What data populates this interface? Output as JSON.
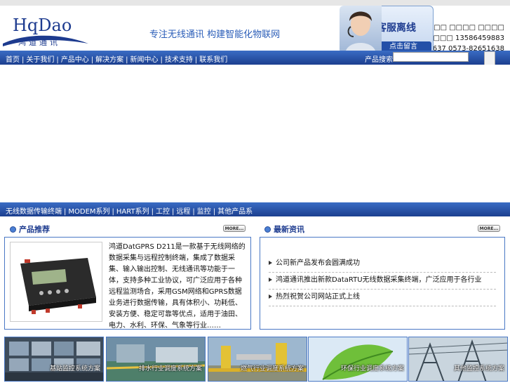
{
  "brand": {
    "logo_en": "HqDao",
    "logo_cn": "鸿道通讯",
    "slogan": "专注无线通讯 构建智能化物联网"
  },
  "customer_service": {
    "status": "客服离线",
    "leave_message": "点击留言"
  },
  "contact": {
    "line1": "□□□□ □□□□ □□□□",
    "line2": "□□□□□□ 13586459883",
    "line3": "1637 0573-82651638"
  },
  "nav": {
    "items": [
      "首页",
      "关于我们",
      "产品中心",
      "解决方案",
      "新闻中心",
      "技术支持",
      "联系我们"
    ]
  },
  "search": {
    "label": "产品搜索",
    "placeholder": ""
  },
  "subnav": {
    "items": [
      "无线数据传输终端",
      "MODEM系列",
      "HART系列",
      "工控",
      "远程",
      "监控",
      "其他产品系"
    ]
  },
  "products": {
    "title": "产品推荐",
    "more": "MORE...",
    "description": "鸿道DatGPRS D211是一款基于无线网络的数据采集与远程控制终端，集成了数据采集、输入输出控制、无线通讯等功能于一体，支持多种工业协议，可广泛应用于各种远程监测场合，采用GSM网络和GPRS数据业务进行数据传输，具有体积小、功耗低、安装方便、稳定可靠等优点，适用于油田、电力、水利、环保、气象等行业……"
  },
  "news": {
    "title": "最新资讯",
    "more": "MORE...",
    "items": [
      "公司新产品发布会圆满成功",
      "鸿道通讯推出新款DataRTU无线数据采集终端，广泛应用于各行业",
      "热烈祝贺公司网站正式上线"
    ]
  },
  "solutions": {
    "tiles": [
      {
        "label": "基站监控系统方案",
        "icon": "monitor-wall-photo"
      },
      {
        "label": "排水行业调度系统方案",
        "icon": "water-plant-photo"
      },
      {
        "label": "燃气行业调度系统方案",
        "icon": "gas-pipeline-photo"
      },
      {
        "label": "环保行业调度系统方案",
        "icon": "green-leaf-photo"
      },
      {
        "label": "其他监控系统方案",
        "icon": "power-substation-photo"
      }
    ]
  },
  "colors": {
    "nav_blue": "#1c3f8f",
    "panel_border": "#4a78c5",
    "title_blue": "#1d3b8f"
  }
}
